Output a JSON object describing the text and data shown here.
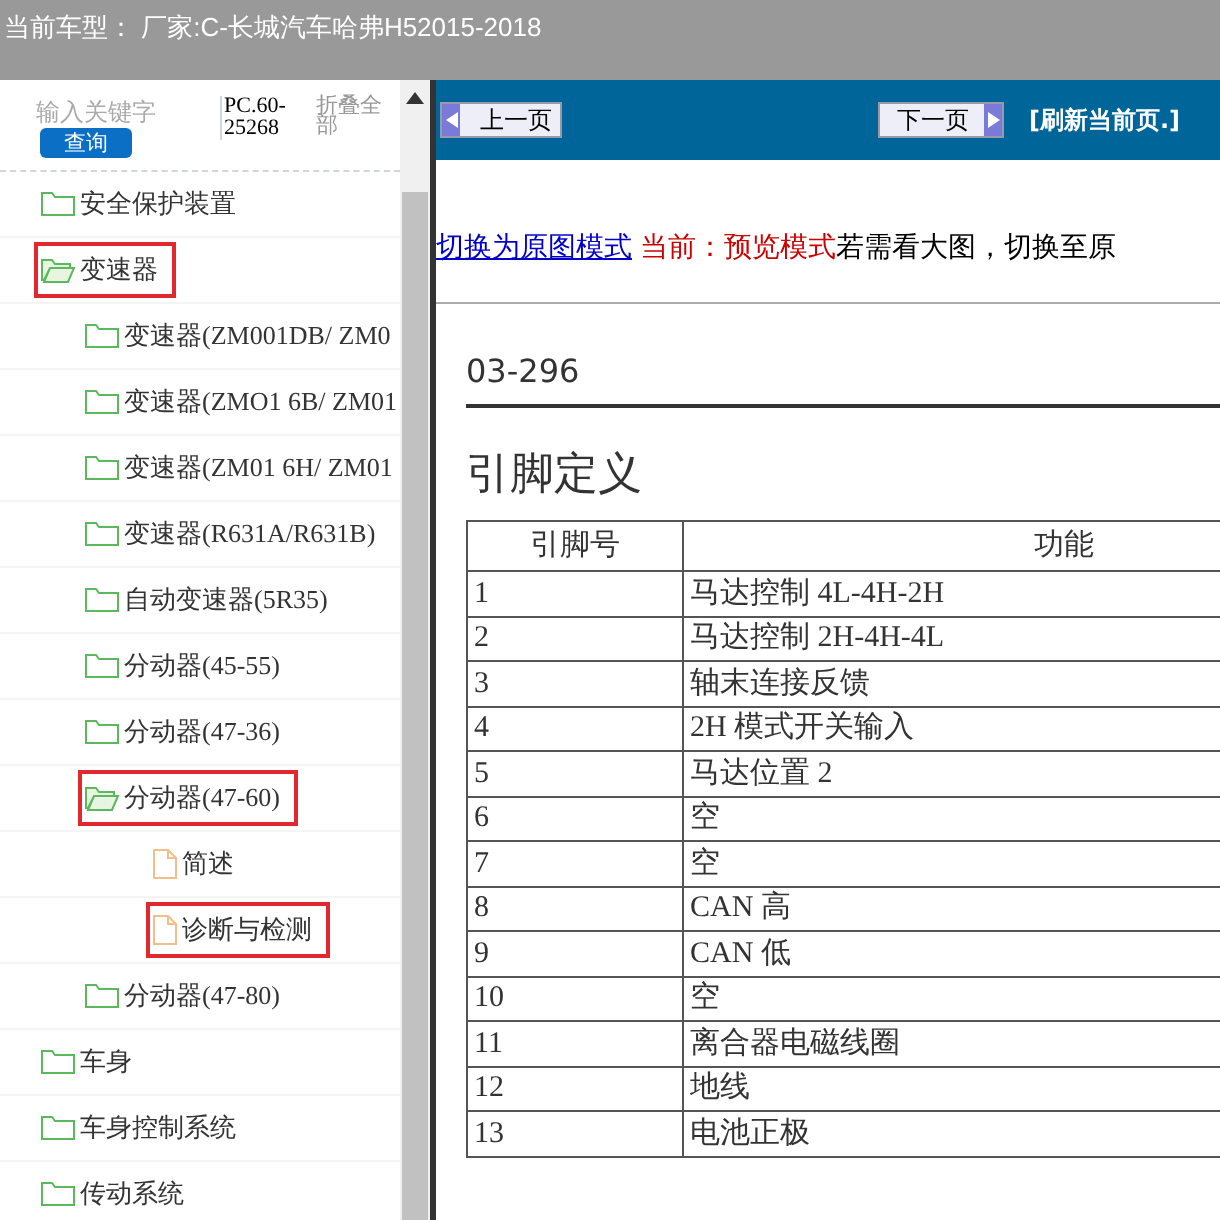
{
  "header": {
    "title": "当前车型： 厂家:C-长城汽车哈弗H52015-2018"
  },
  "sidebar": {
    "search": {
      "placeholder": "输入关键字"
    },
    "search_button": "查询",
    "code": "PC.60-25268",
    "collapse_all": "折叠全部",
    "tree": [
      {
        "label": "安全保护装置",
        "kind": "folder",
        "expanded": false,
        "selected": false
      },
      {
        "label": "变速器",
        "kind": "folder",
        "expanded": true,
        "selected": true,
        "children": [
          {
            "label": "变速器(ZM001DB/ ZM0",
            "kind": "folder",
            "expanded": false,
            "selected": false
          },
          {
            "label": "变速器(ZMO1 6B/ ZM01",
            "kind": "folder",
            "expanded": false,
            "selected": false
          },
          {
            "label": "变速器(ZM01 6H/ ZM01",
            "kind": "folder",
            "expanded": false,
            "selected": false
          },
          {
            "label": "变速器(R631A/R631B)",
            "kind": "folder",
            "expanded": false,
            "selected": false
          },
          {
            "label": "自动变速器(5R35)",
            "kind": "folder",
            "expanded": false,
            "selected": false
          },
          {
            "label": "分动器(45-55)",
            "kind": "folder",
            "expanded": false,
            "selected": false
          },
          {
            "label": "分动器(47-36)",
            "kind": "folder",
            "expanded": false,
            "selected": false
          },
          {
            "label": "分动器(47-60)",
            "kind": "folder",
            "expanded": true,
            "selected": true,
            "children": [
              {
                "label": "简述",
                "kind": "page",
                "selected": false
              },
              {
                "label": "诊断与检测",
                "kind": "page",
                "selected": true
              }
            ]
          },
          {
            "label": "分动器(47-80)",
            "kind": "folder",
            "expanded": false,
            "selected": false
          }
        ]
      },
      {
        "label": "车身",
        "kind": "folder",
        "expanded": false,
        "selected": false
      },
      {
        "label": "车身控制系统",
        "kind": "folder",
        "expanded": false,
        "selected": false
      },
      {
        "label": "传动系统",
        "kind": "folder",
        "expanded": false,
        "selected": false
      }
    ]
  },
  "toolbar": {
    "prev": "上一页",
    "next": "下一页",
    "refresh": "[刷新当前页.]"
  },
  "notice": {
    "link": "切换为原图模式",
    "current": "当前：预览模式",
    "hint": "若需看大图，切换至原"
  },
  "document": {
    "page_number": "03-296",
    "heading": "引脚定义",
    "columns": [
      "引脚号",
      "功能"
    ],
    "rows": [
      [
        "1",
        "马达控制 4L-4H-2H"
      ],
      [
        "2",
        "马达控制 2H-4H-4L"
      ],
      [
        "3",
        "轴末连接反馈"
      ],
      [
        "4",
        "2H 模式开关输入"
      ],
      [
        "5",
        "马达位置 2"
      ],
      [
        "6",
        "空"
      ],
      [
        "7",
        "空"
      ],
      [
        "8",
        "CAN 高"
      ],
      [
        "9",
        "CAN 低"
      ],
      [
        "10",
        "空"
      ],
      [
        "11",
        "离合器电磁线圈"
      ],
      [
        "12",
        "地线"
      ],
      [
        "13",
        "电池正极"
      ]
    ]
  }
}
